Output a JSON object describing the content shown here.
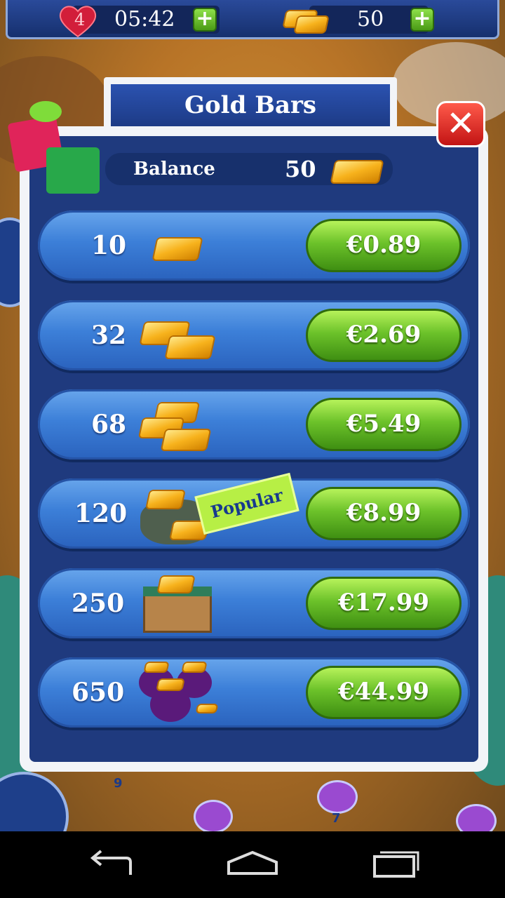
{
  "hud": {
    "lives": "4",
    "timer": "05:42",
    "gold": "50",
    "plus_label": "+"
  },
  "dialog": {
    "title": "Gold Bars",
    "close_label": "✕",
    "balance_label": "Balance",
    "balance_value": "50",
    "popular_label": "Popular"
  },
  "offers": [
    {
      "qty": "10",
      "price": "€0.89"
    },
    {
      "qty": "32",
      "price": "€2.69"
    },
    {
      "qty": "68",
      "price": "€5.49"
    },
    {
      "qty": "120",
      "price": "€8.99"
    },
    {
      "qty": "250",
      "price": "€17.99"
    },
    {
      "qty": "650",
      "price": "€44.99"
    }
  ],
  "map": {
    "level_numbers": [
      "9",
      "7"
    ]
  },
  "colors": {
    "dialog_blue": "#1f3a7e",
    "row_blue": "#3c7fd8",
    "price_green": "#6cc22a",
    "close_red": "#c21414",
    "popular_green": "#b7ef45"
  }
}
